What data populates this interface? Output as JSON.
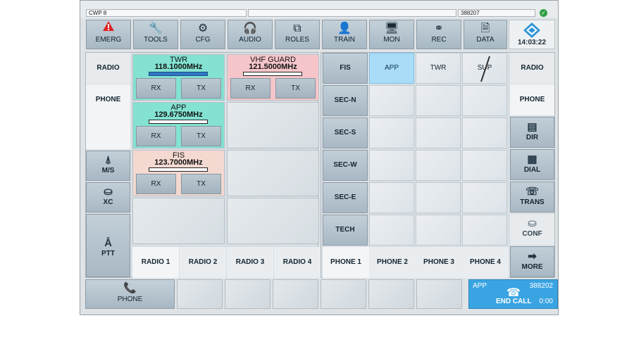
{
  "status_bar": {
    "position": "CWP 8",
    "message": "",
    "number": "388207"
  },
  "toolbar": {
    "left": [
      {
        "label": "EMERG",
        "icon": "warning-icon"
      },
      {
        "label": "TOOLS",
        "icon": "wrench-icon"
      },
      {
        "label": "CFG",
        "icon": "gears-icon"
      },
      {
        "label": "AUDIO",
        "icon": "headset-icon"
      },
      {
        "label": "ROLES",
        "icon": "cube-icon"
      }
    ],
    "right": [
      {
        "label": "TRAIN",
        "icon": "trainee-icon"
      },
      {
        "label": "MON",
        "icon": "monitor-icon"
      },
      {
        "label": "REC",
        "icon": "voicemail-icon"
      },
      {
        "label": "DATA",
        "icon": "document-icon"
      }
    ],
    "time": "14:03:22"
  },
  "left_panel": {
    "side": [
      {
        "label": "RADIO"
      },
      {
        "label": "PHONE"
      },
      {
        "label": "M/S",
        "icon": "antenna-icon"
      },
      {
        "label": "XC",
        "icon": "crosscouple-icon"
      },
      {
        "label": "PTT",
        "icon": "ptt-icon"
      }
    ],
    "radios": [
      {
        "name": "TWR",
        "freq": "118.1000MHz",
        "rx": "RX",
        "tx": "TX",
        "color": "#83e2d1"
      },
      {
        "name": "VHF GUARD",
        "freq": "121.5000MHz",
        "rx": "RX",
        "tx": "TX",
        "color": "#f6c5ca"
      },
      {
        "name": "APP",
        "freq": "129.6750MHz",
        "rx": "RX",
        "tx": "TX",
        "color": "#83e2d1"
      },
      {
        "name": "FIS",
        "freq": "123.7000MHz",
        "rx": "RX",
        "tx": "TX",
        "color": "#f3d9d0"
      }
    ],
    "tabs": [
      "RADIO 1",
      "RADIO 2",
      "RADIO 3",
      "RADIO 4"
    ]
  },
  "right_panel": {
    "grid_row0": [
      "FIS",
      "APP",
      "TWR",
      "SUP"
    ],
    "grid_col0": [
      "SEC-N",
      "SEC-S",
      "SEC-W",
      "SEC-E",
      "TECH"
    ],
    "tabs": [
      "PHONE 1",
      "PHONE 2",
      "PHONE 3",
      "PHONE 4"
    ],
    "side": [
      {
        "label": "RADIO"
      },
      {
        "label": "PHONE"
      },
      {
        "label": "DIR",
        "icon": "directory-icon"
      },
      {
        "label": "DIAL",
        "icon": "dialpad-icon"
      },
      {
        "label": "TRANS",
        "icon": "transfer-icon"
      },
      {
        "label": "CONF",
        "icon": "conference-icon"
      },
      {
        "label": "MORE",
        "icon": "arrow-right-icon"
      }
    ]
  },
  "bottom_bar": {
    "phone_label": "PHONE",
    "call": {
      "party": "APP",
      "number": "388202",
      "action": "END CALL",
      "duration": "0:00"
    }
  },
  "colors": {
    "active": "#a9dcf7",
    "call": "#3aa4e2",
    "toolbar": "#b4c4cf"
  }
}
